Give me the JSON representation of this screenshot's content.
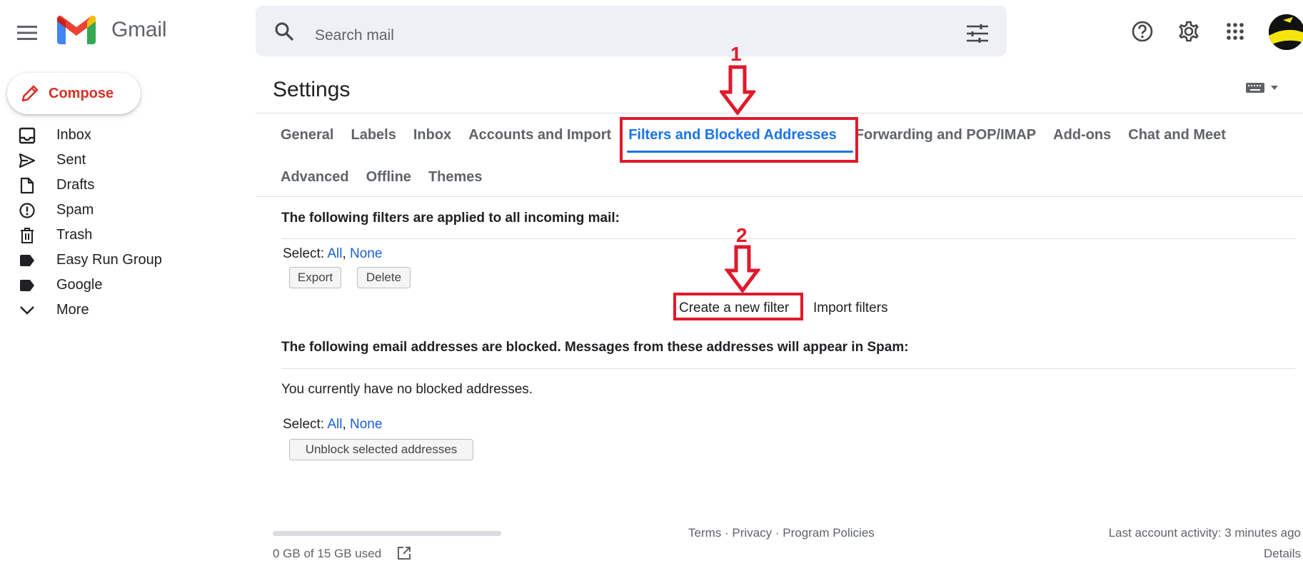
{
  "app": {
    "name": "Gmail"
  },
  "search": {
    "placeholder": "Search mail"
  },
  "compose": {
    "label": "Compose"
  },
  "nav": {
    "items": [
      {
        "label": "Inbox",
        "icon": "inbox-icon"
      },
      {
        "label": "Sent",
        "icon": "send-icon"
      },
      {
        "label": "Drafts",
        "icon": "draft-icon"
      },
      {
        "label": "Spam",
        "icon": "spam-icon"
      },
      {
        "label": "Trash",
        "icon": "trash-icon"
      },
      {
        "label": "Easy Run Group",
        "icon": "label-icon"
      },
      {
        "label": "Google",
        "icon": "label-icon"
      },
      {
        "label": "More",
        "icon": "chevron-down-icon"
      }
    ]
  },
  "settings": {
    "title": "Settings",
    "tabs": [
      {
        "label": "General"
      },
      {
        "label": "Labels"
      },
      {
        "label": "Inbox"
      },
      {
        "label": "Accounts and Import"
      },
      {
        "label": "Filters and Blocked Addresses"
      },
      {
        "label": "Forwarding and POP/IMAP"
      },
      {
        "label": "Add-ons"
      },
      {
        "label": "Chat and Meet"
      },
      {
        "label": "Advanced"
      },
      {
        "label": "Offline"
      },
      {
        "label": "Themes"
      }
    ],
    "active_tab": "Filters and Blocked Addresses"
  },
  "filters": {
    "heading": "The following filters are applied to all incoming mail:",
    "select_label": "Select:",
    "select_all": "All",
    "select_sep": ",",
    "select_none": "None",
    "export_label": "Export",
    "delete_label": "Delete",
    "create_filter_label": "Create a new filter",
    "import_filters_label": "Import filters"
  },
  "blocked": {
    "heading": "The following email addresses are blocked. Messages from these addresses will appear in Spam:",
    "empty_text": "You currently have no blocked addresses.",
    "select_label": "Select:",
    "select_all": "All",
    "select_sep": ",",
    "select_none": "None",
    "unblock_label": "Unblock selected addresses"
  },
  "annotations": {
    "step1": "1",
    "step2": "2",
    "color": "#e0192b"
  },
  "footer": {
    "storage_text": "0 GB of 15 GB used",
    "storage_used_fraction": 0,
    "terms": "Terms",
    "privacy": "Privacy",
    "program_policies": "Program Policies",
    "sep": "·",
    "last_activity": "Last account activity: 3 minutes ago",
    "details": "Details"
  },
  "colors": {
    "accent": "#1a73e8",
    "link": "#1a5fd4",
    "compose_text": "#d93025",
    "annotation": "#e0192b"
  }
}
